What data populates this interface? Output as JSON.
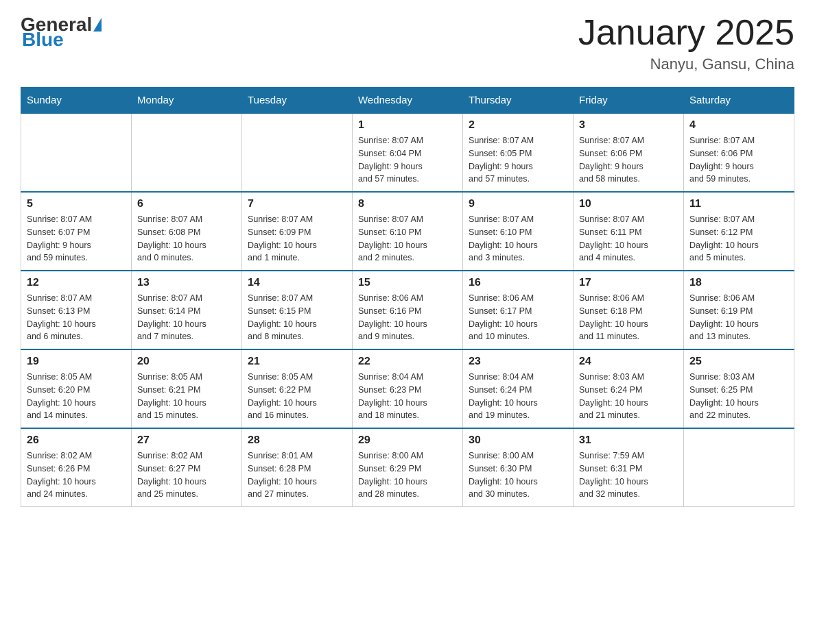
{
  "header": {
    "logo_general": "General",
    "logo_blue": "Blue",
    "title": "January 2025",
    "subtitle": "Nanyu, Gansu, China"
  },
  "weekdays": [
    "Sunday",
    "Monday",
    "Tuesday",
    "Wednesday",
    "Thursday",
    "Friday",
    "Saturday"
  ],
  "weeks": [
    [
      {
        "day": "",
        "info": ""
      },
      {
        "day": "",
        "info": ""
      },
      {
        "day": "",
        "info": ""
      },
      {
        "day": "1",
        "info": "Sunrise: 8:07 AM\nSunset: 6:04 PM\nDaylight: 9 hours\nand 57 minutes."
      },
      {
        "day": "2",
        "info": "Sunrise: 8:07 AM\nSunset: 6:05 PM\nDaylight: 9 hours\nand 57 minutes."
      },
      {
        "day": "3",
        "info": "Sunrise: 8:07 AM\nSunset: 6:06 PM\nDaylight: 9 hours\nand 58 minutes."
      },
      {
        "day": "4",
        "info": "Sunrise: 8:07 AM\nSunset: 6:06 PM\nDaylight: 9 hours\nand 59 minutes."
      }
    ],
    [
      {
        "day": "5",
        "info": "Sunrise: 8:07 AM\nSunset: 6:07 PM\nDaylight: 9 hours\nand 59 minutes."
      },
      {
        "day": "6",
        "info": "Sunrise: 8:07 AM\nSunset: 6:08 PM\nDaylight: 10 hours\nand 0 minutes."
      },
      {
        "day": "7",
        "info": "Sunrise: 8:07 AM\nSunset: 6:09 PM\nDaylight: 10 hours\nand 1 minute."
      },
      {
        "day": "8",
        "info": "Sunrise: 8:07 AM\nSunset: 6:10 PM\nDaylight: 10 hours\nand 2 minutes."
      },
      {
        "day": "9",
        "info": "Sunrise: 8:07 AM\nSunset: 6:10 PM\nDaylight: 10 hours\nand 3 minutes."
      },
      {
        "day": "10",
        "info": "Sunrise: 8:07 AM\nSunset: 6:11 PM\nDaylight: 10 hours\nand 4 minutes."
      },
      {
        "day": "11",
        "info": "Sunrise: 8:07 AM\nSunset: 6:12 PM\nDaylight: 10 hours\nand 5 minutes."
      }
    ],
    [
      {
        "day": "12",
        "info": "Sunrise: 8:07 AM\nSunset: 6:13 PM\nDaylight: 10 hours\nand 6 minutes."
      },
      {
        "day": "13",
        "info": "Sunrise: 8:07 AM\nSunset: 6:14 PM\nDaylight: 10 hours\nand 7 minutes."
      },
      {
        "day": "14",
        "info": "Sunrise: 8:07 AM\nSunset: 6:15 PM\nDaylight: 10 hours\nand 8 minutes."
      },
      {
        "day": "15",
        "info": "Sunrise: 8:06 AM\nSunset: 6:16 PM\nDaylight: 10 hours\nand 9 minutes."
      },
      {
        "day": "16",
        "info": "Sunrise: 8:06 AM\nSunset: 6:17 PM\nDaylight: 10 hours\nand 10 minutes."
      },
      {
        "day": "17",
        "info": "Sunrise: 8:06 AM\nSunset: 6:18 PM\nDaylight: 10 hours\nand 11 minutes."
      },
      {
        "day": "18",
        "info": "Sunrise: 8:06 AM\nSunset: 6:19 PM\nDaylight: 10 hours\nand 13 minutes."
      }
    ],
    [
      {
        "day": "19",
        "info": "Sunrise: 8:05 AM\nSunset: 6:20 PM\nDaylight: 10 hours\nand 14 minutes."
      },
      {
        "day": "20",
        "info": "Sunrise: 8:05 AM\nSunset: 6:21 PM\nDaylight: 10 hours\nand 15 minutes."
      },
      {
        "day": "21",
        "info": "Sunrise: 8:05 AM\nSunset: 6:22 PM\nDaylight: 10 hours\nand 16 minutes."
      },
      {
        "day": "22",
        "info": "Sunrise: 8:04 AM\nSunset: 6:23 PM\nDaylight: 10 hours\nand 18 minutes."
      },
      {
        "day": "23",
        "info": "Sunrise: 8:04 AM\nSunset: 6:24 PM\nDaylight: 10 hours\nand 19 minutes."
      },
      {
        "day": "24",
        "info": "Sunrise: 8:03 AM\nSunset: 6:24 PM\nDaylight: 10 hours\nand 21 minutes."
      },
      {
        "day": "25",
        "info": "Sunrise: 8:03 AM\nSunset: 6:25 PM\nDaylight: 10 hours\nand 22 minutes."
      }
    ],
    [
      {
        "day": "26",
        "info": "Sunrise: 8:02 AM\nSunset: 6:26 PM\nDaylight: 10 hours\nand 24 minutes."
      },
      {
        "day": "27",
        "info": "Sunrise: 8:02 AM\nSunset: 6:27 PM\nDaylight: 10 hours\nand 25 minutes."
      },
      {
        "day": "28",
        "info": "Sunrise: 8:01 AM\nSunset: 6:28 PM\nDaylight: 10 hours\nand 27 minutes."
      },
      {
        "day": "29",
        "info": "Sunrise: 8:00 AM\nSunset: 6:29 PM\nDaylight: 10 hours\nand 28 minutes."
      },
      {
        "day": "30",
        "info": "Sunrise: 8:00 AM\nSunset: 6:30 PM\nDaylight: 10 hours\nand 30 minutes."
      },
      {
        "day": "31",
        "info": "Sunrise: 7:59 AM\nSunset: 6:31 PM\nDaylight: 10 hours\nand 32 minutes."
      },
      {
        "day": "",
        "info": ""
      }
    ]
  ]
}
